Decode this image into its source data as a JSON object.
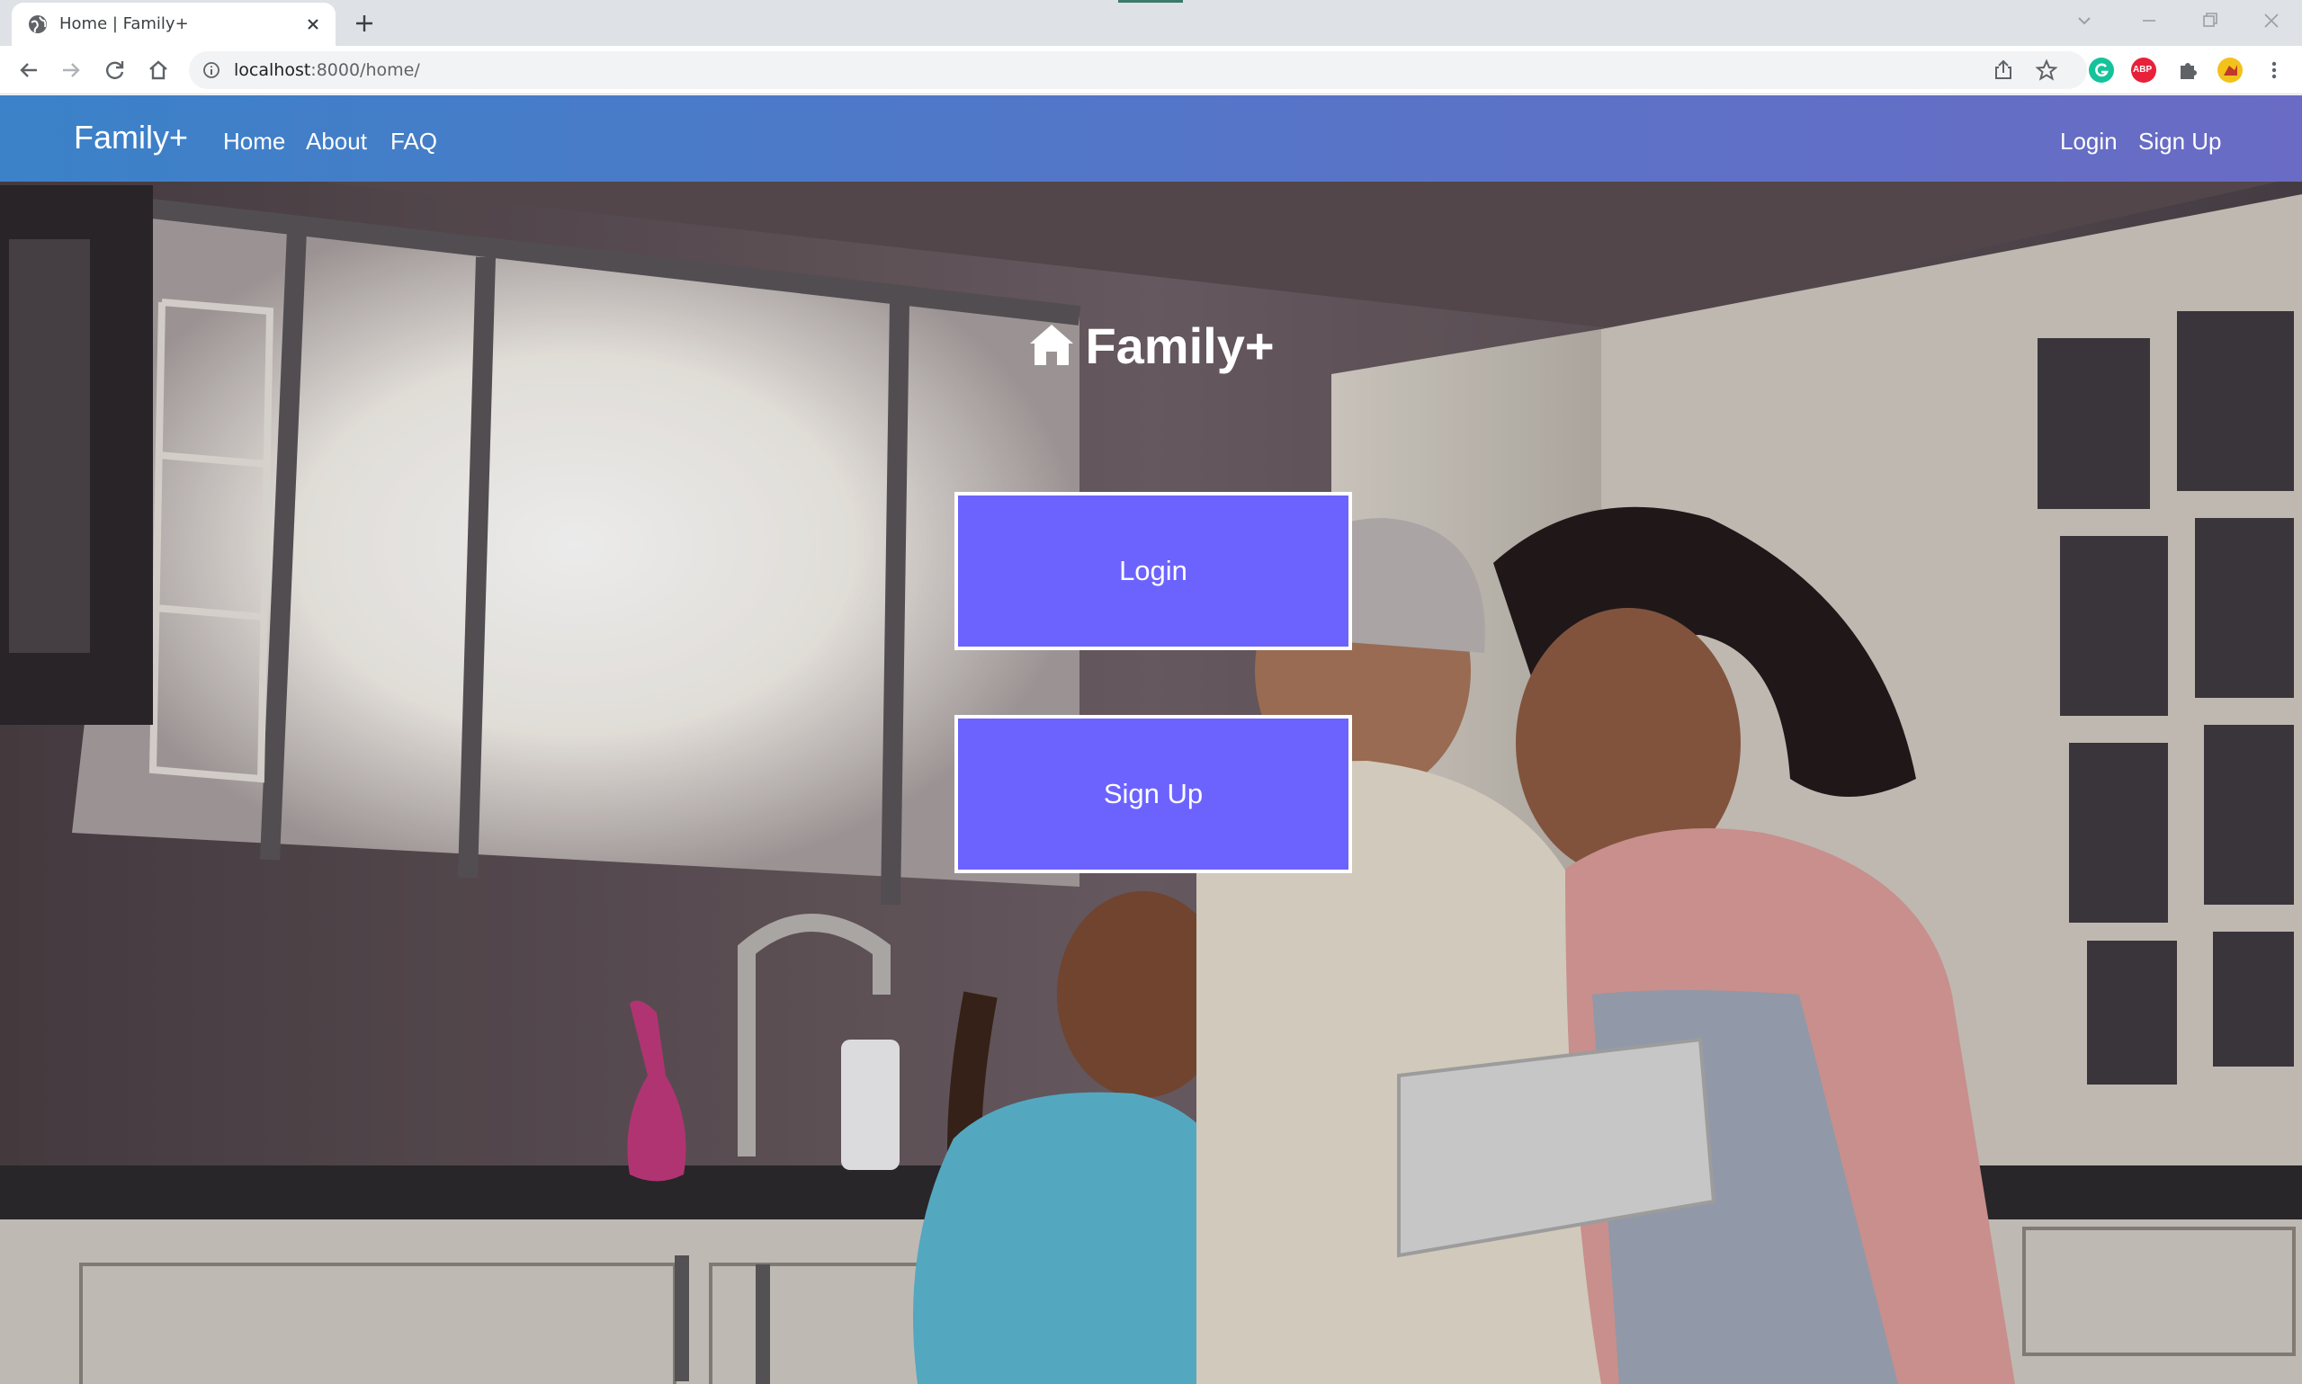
{
  "browser": {
    "tab_title": "Home | Family+",
    "url_host": "localhost",
    "url_rest": ":8000/home/",
    "extensions": [
      {
        "icon": "grammarly-icon",
        "color": "#15c39a",
        "label": ""
      },
      {
        "icon": "adblock-plus-icon",
        "color": "#e8203a",
        "label": "ABP"
      },
      {
        "icon": "puzzle-extensions-icon",
        "color": "#5f6368",
        "label": ""
      },
      {
        "icon": "profile-avatar-icon",
        "color": "#f2c21b",
        "label": ""
      }
    ]
  },
  "navbar": {
    "brand": "Family+",
    "links": [
      "Home",
      "About",
      "FAQ"
    ],
    "login": "Login",
    "signup": "Sign Up",
    "gradient": [
      "#3b82c8",
      "#6a6bc4"
    ]
  },
  "hero": {
    "title": "Family+",
    "login_button": "Login",
    "signup_button": "Sign Up",
    "button_color": "#6c63ff"
  }
}
